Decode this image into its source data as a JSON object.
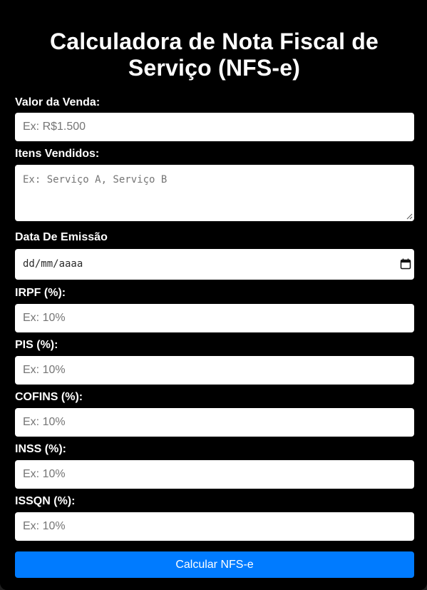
{
  "form": {
    "title_line1": "Calculadora de Nota Fiscal de",
    "title_line2": "Serviço (NFS-e)",
    "fields": [
      {
        "label": "Valor da Venda:",
        "placeholder": "Ex: R$1.500"
      },
      {
        "label": "Itens Vendidos:",
        "placeholder": "Ex: Serviço A, Serviço B"
      },
      {
        "label": "Data De Emissão",
        "placeholder": "dd/mm/aaaa"
      },
      {
        "label": "IRPF (%):",
        "placeholder": "Ex: 10%"
      },
      {
        "label": "PIS (%):",
        "placeholder": "Ex: 10%"
      },
      {
        "label": "COFINS (%):",
        "placeholder": "Ex: 10%"
      },
      {
        "label": "INSS (%):",
        "placeholder": "Ex: 10%"
      },
      {
        "label": "ISSQN (%):",
        "placeholder": "Ex: 10%"
      }
    ],
    "submit_label": "Calcular NFS-e"
  },
  "colors": {
    "page_background": "#000000",
    "button_background": "#007bff",
    "label_text": "#ffffff",
    "placeholder_text": "#757575"
  },
  "icons": {
    "date_picker": "calendar-icon",
    "textarea_resize": "resize-handle-icon"
  }
}
